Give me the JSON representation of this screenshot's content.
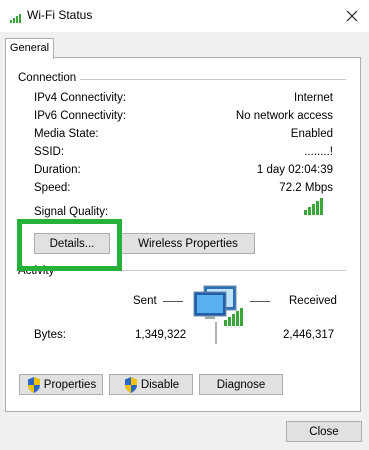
{
  "window": {
    "title": "Wi-Fi Status",
    "icon": "wifi-signal-icon",
    "close_icon": "close-icon"
  },
  "tabs": [
    {
      "label": "General",
      "selected": true
    }
  ],
  "connection": {
    "section_label": "Connection",
    "rows": [
      {
        "label": "IPv4 Connectivity:",
        "value": "Internet"
      },
      {
        "label": "IPv6 Connectivity:",
        "value": "No network access"
      },
      {
        "label": "Media State:",
        "value": "Enabled"
      },
      {
        "label": "SSID:",
        "value": "........!"
      },
      {
        "label": "Duration:",
        "value": "1 day 02:04:39"
      },
      {
        "label": "Speed:",
        "value": "72.2 Mbps"
      }
    ],
    "signal_quality_label": "Signal Quality:",
    "signal_bars": 5,
    "signal_icon": "signal-strength-icon",
    "details_button": "Details...",
    "wireless_properties_button": "Wireless Properties"
  },
  "activity": {
    "section_label": "Activity",
    "sent_label": "Sent",
    "received_label": "Received",
    "bytes_label": "Bytes:",
    "bytes_sent": "1,349,322",
    "bytes_received": "2,446,317",
    "icon": "network-computers-icon"
  },
  "buttons": {
    "properties": "Properties",
    "disable": "Disable",
    "diagnose": "Diagnose",
    "close": "Close",
    "shield_icon": "uac-shield-icon"
  },
  "colors": {
    "highlight": "#25b13a",
    "signal_green": "#3aa53a"
  }
}
